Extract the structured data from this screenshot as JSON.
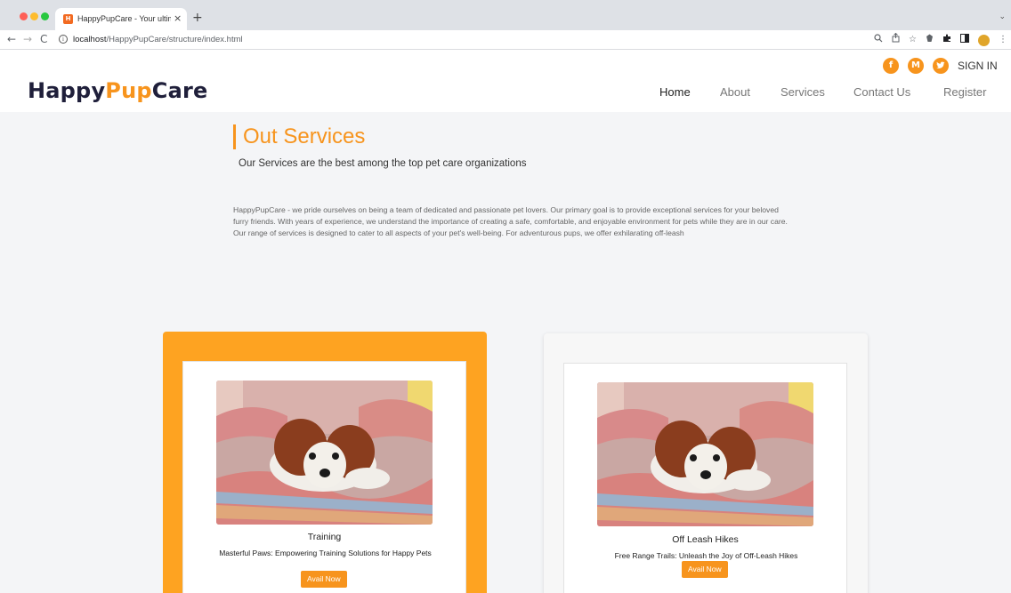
{
  "browser": {
    "tab_title": "HappyPupCare - Your ultimate",
    "tab_favicon": "happypupcare-favicon",
    "new_tab_label": "+",
    "url_host": "localhost",
    "url_path": "/HappyPupCare/structure/index.html"
  },
  "site": {
    "logo_part1": "Happy",
    "logo_part2": "Pup",
    "logo_part3": "Care",
    "sign_in": "SIGN IN",
    "social": [
      "facebook-icon",
      "gmail-icon",
      "twitter-icon"
    ],
    "nav": [
      "Home",
      "About",
      "Services",
      "Contact Us",
      "Register"
    ],
    "accent_color": "#f7941d"
  },
  "services": {
    "title": "Out Services",
    "subtitle": "Our Services are the best among the top pet care organizations",
    "body": "HappyPupCare - we pride ourselves on being a team of dedicated and passionate pet lovers. Our primary goal is to provide exceptional services for your beloved furry friends. With years of experience, we understand the importance of creating a safe, comfortable, and enjoyable environment for pets while they are in our care. Our range of services is designed to cater to all aspects of your pet's well-being. For adventurous pups, we offer exhilarating off-leash",
    "cards": [
      {
        "title": "Training",
        "description": "Masterful Paws: Empowering Training Solutions for Happy Pets",
        "button": "Avail Now"
      },
      {
        "title": "Off Leash Hikes",
        "description": "Free Range Trails: Unleash the Joy of Off-Leash Hikes",
        "button": "Avail Now"
      }
    ]
  }
}
